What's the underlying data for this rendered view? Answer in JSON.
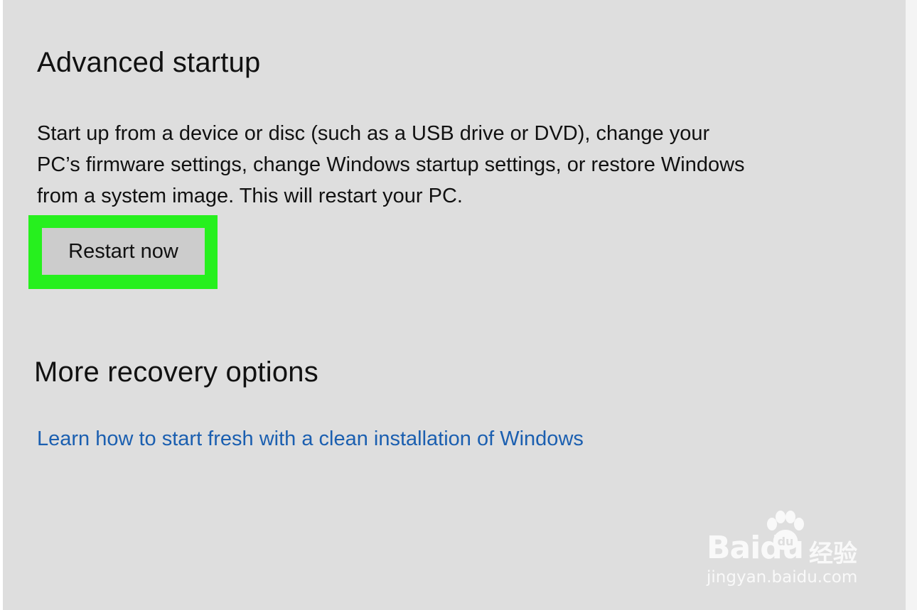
{
  "advanced_startup": {
    "title": "Advanced startup",
    "description": "Start up from a device or disc (such as a USB drive or DVD), change your PC’s firmware settings, change Windows startup settings, or restore Windows from a system image. This will restart your PC.",
    "restart_button_label": "Restart now"
  },
  "more_recovery": {
    "title": "More recovery options",
    "link_text": "Learn how to start fresh with a clean installation of Windows"
  },
  "watermark": {
    "brand": "Baidu",
    "brand_cn": "经验",
    "url": "jingyan.baidu.com",
    "icon": "paw-icon"
  },
  "colors": {
    "panel_background": "#dedede",
    "highlight": "#26f01e",
    "link": "#1b5fb0",
    "button_background": "#cccccc"
  }
}
